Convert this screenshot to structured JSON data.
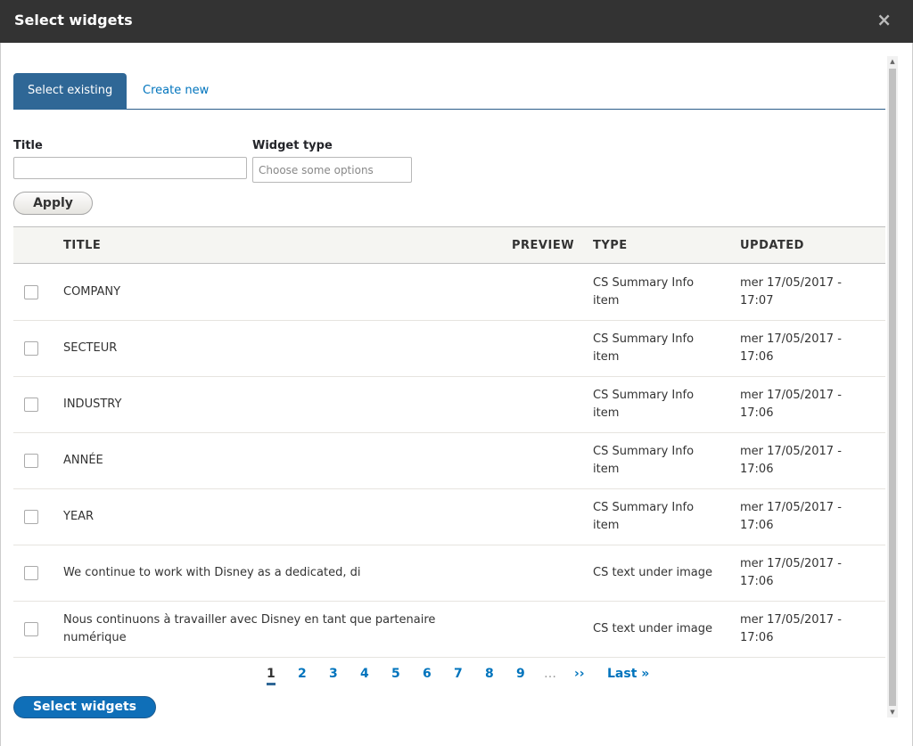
{
  "dialog": {
    "title": "Select widgets",
    "close_icon": "×"
  },
  "tabs": [
    {
      "label": "Select existing",
      "active": true
    },
    {
      "label": "Create new",
      "active": false
    }
  ],
  "filters": {
    "title_label": "Title",
    "title_value": "",
    "widget_type_label": "Widget type",
    "widget_type_placeholder": "Choose some options",
    "apply_label": "Apply"
  },
  "table": {
    "headers": {
      "title": "TITLE",
      "preview": "PREVIEW",
      "type": "TYPE",
      "updated": "UPDATED"
    },
    "rows": [
      {
        "title": "COMPANY",
        "type": [
          "CS Summary Info",
          "item"
        ],
        "updated": [
          "mer 17/05/2017 -",
          "17:07"
        ]
      },
      {
        "title": "SECTEUR",
        "type": [
          "CS Summary Info",
          "item"
        ],
        "updated": [
          "mer 17/05/2017 -",
          "17:06"
        ]
      },
      {
        "title": "INDUSTRY",
        "type": [
          "CS Summary Info",
          "item"
        ],
        "updated": [
          "mer 17/05/2017 -",
          "17:06"
        ]
      },
      {
        "title": "ANNÉE",
        "type": [
          "CS Summary Info",
          "item"
        ],
        "updated": [
          "mer 17/05/2017 -",
          "17:06"
        ]
      },
      {
        "title": "YEAR",
        "type": [
          "CS Summary Info",
          "item"
        ],
        "updated": [
          "mer 17/05/2017 -",
          "17:06"
        ]
      },
      {
        "title": "We continue to work with Disney as a dedicated, di",
        "type": [
          "CS text under image"
        ],
        "updated": [
          "mer 17/05/2017 -",
          "17:06"
        ]
      },
      {
        "title": "Nous continuons à travailler avec Disney en tant que partenaire numérique",
        "type": [
          "CS text under image"
        ],
        "updated": [
          "mer 17/05/2017 -",
          "17:06"
        ]
      }
    ]
  },
  "pager": {
    "pages": [
      "1",
      "2",
      "3",
      "4",
      "5",
      "6",
      "7",
      "8",
      "9"
    ],
    "current": "1",
    "ellipsis": "…",
    "next": "››",
    "last": "Last »"
  },
  "submit_label": "Select widgets",
  "colors": {
    "accent": "#0074bd",
    "tab_active": "#2f6796",
    "titlebar": "#333333"
  }
}
